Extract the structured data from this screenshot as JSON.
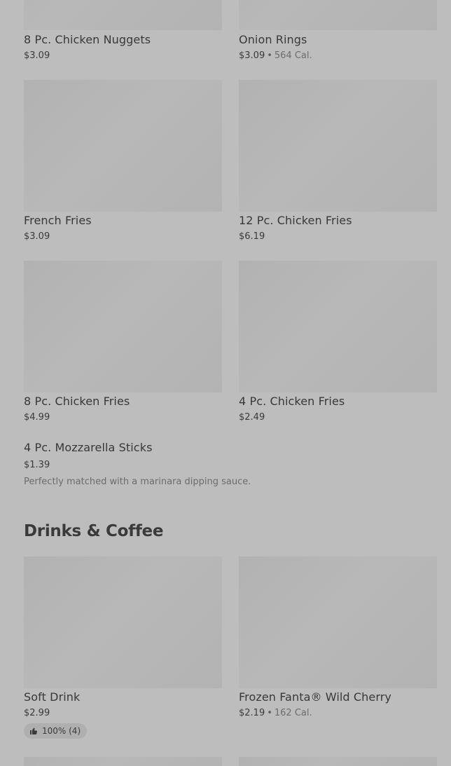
{
  "items": [
    {
      "name": "8 Pc. Chicken Nuggets",
      "price": "$3.09",
      "cal": ""
    },
    {
      "name": "Onion Rings",
      "price": "$3.09",
      "cal": "564 Cal."
    },
    {
      "name": "French Fries",
      "price": "$3.09",
      "cal": ""
    },
    {
      "name": "12 Pc. Chicken Fries",
      "price": "$6.19",
      "cal": ""
    },
    {
      "name": "8 Pc. Chicken Fries",
      "price": "$4.99",
      "cal": ""
    },
    {
      "name": "4 Pc. Chicken Fries",
      "price": "$2.49",
      "cal": ""
    },
    {
      "name": "4 Pc. Mozzarella Sticks",
      "price": "$1.39",
      "description": "Perfectly matched with a marinara dipping sauce."
    }
  ],
  "drinks_section": {
    "title": "Drinks & Coffee",
    "items": [
      {
        "name": "Soft Drink",
        "price": "$2.99",
        "rating": "100% (4)"
      },
      {
        "name": "Frozen Fanta® Wild Cherry",
        "price": "$2.19",
        "cal": "162 Cal."
      }
    ]
  },
  "separator": "•",
  "icons": {
    "rating": "thumbs-up-icon"
  },
  "colors": {
    "background": "#bdbdbd",
    "thumbnail": "#b4b4b4",
    "badge": "#afafaf"
  }
}
